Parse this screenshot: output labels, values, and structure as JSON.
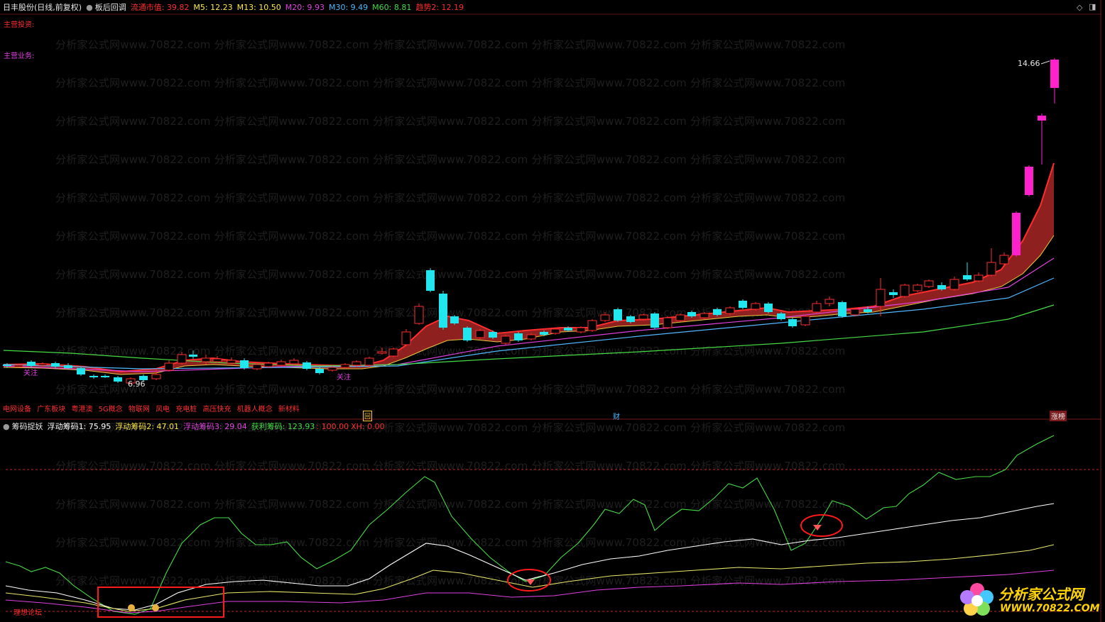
{
  "header": {
    "stock_name": "日丰股份",
    "period": "(日线,前复权)",
    "strategy": "板后回调",
    "indicators": [
      {
        "label": "流通市值: 39.82",
        "color": "#ff2d2d"
      },
      {
        "label": "M5: 12.23",
        "color": "#ffe94a"
      },
      {
        "label": "M13: 10.50",
        "color": "#ffe94a"
      },
      {
        "label": "M20: 9.93",
        "color": "#e040e0"
      },
      {
        "label": "M30: 9.49",
        "color": "#4fb8ff"
      },
      {
        "label": "M60: 8.81",
        "color": "#44dd44"
      },
      {
        "label": "趋势2: 12.19",
        "color": "#ff2d2d"
      }
    ]
  },
  "main_pane": {
    "label_main_investment": "主营投资:",
    "label_main_business": "主营业务:",
    "high_price": "14.66",
    "low_price": "6.96",
    "attention_1": "关注",
    "attention_2": "关注",
    "tags": [
      "电网设备",
      "广东板块",
      "粤港澳",
      "5G概念",
      "物联网",
      "风电",
      "充电桩",
      "高压快充",
      "机器人概念",
      "新材料"
    ],
    "marker_event": "回",
    "marker_fin": "财",
    "marker_limit": "涨榜"
  },
  "indicator_bar": {
    "name": "筹码捉妖",
    "items": [
      {
        "label": "浮动筹码1: 75.95",
        "color": "#ffffff"
      },
      {
        "label": "浮动筹码2: 47.01",
        "color": "#ffe94a"
      },
      {
        "label": "浮动筹码3: 29.04",
        "color": "#e040e0"
      },
      {
        "label": "获利筹码: 123.93",
        "color": "#44dd44"
      },
      {
        "label": ": 100.00",
        "color": "#ff2d2d"
      },
      {
        "label": "XH: 0.00",
        "color": "#ff2d2d"
      }
    ]
  },
  "lower_pane": {
    "label_bottom": "理想论坛"
  },
  "watermark": "分析家公式网www.70822.com 分析家公式网www.70822.com 分析家公式网www.70822.com 分析家公式网www.70822.com 分析家公式网www.70822.com",
  "logo": {
    "title": "分析家公式网",
    "url": "WWW.70822.COM"
  },
  "colors": {
    "up": "#ff2d2d",
    "down": "#22e6ee",
    "limit_up": "#ff22cc"
  }
}
